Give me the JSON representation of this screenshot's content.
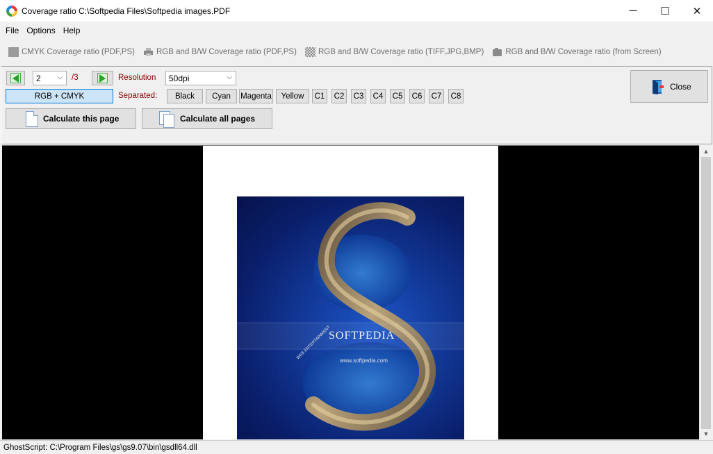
{
  "window": {
    "title": "Coverage ratio  C:\\Softpedia Files\\Softpedia images.PDF",
    "controls": [
      "─",
      "☐",
      "✕"
    ]
  },
  "menu": [
    "File",
    "Options",
    "Help"
  ],
  "mode_tabs": [
    {
      "label": "CMYK Coverage ratio  (PDF,PS)",
      "icon": "cmyk-square-icon"
    },
    {
      "label": "RGB and B/W Coverage ratio (PDF,PS)",
      "icon": "printer-icon"
    },
    {
      "label": "RGB and B/W Coverage ratio  (TIFF,JPG,BMP)",
      "icon": "checker-image-icon"
    },
    {
      "label": "RGB and B/W Coverage ratio  (from Screen)",
      "icon": "camera-icon"
    }
  ],
  "controls": {
    "page_value": "2",
    "page_total": "/3",
    "resolution_label": "Resolution",
    "resolution_value": "50dpi",
    "rgb_cmyk_label": "RGB + CMYK",
    "separated_label": "Separated:",
    "separations": [
      "Black",
      "Cyan",
      "Magenta",
      "Yellow",
      "C1",
      "C2",
      "C3",
      "C4",
      "C5",
      "C6",
      "C7",
      "C8"
    ],
    "calc_page_label": "Calculate this page",
    "calc_all_label": "Calculate all pages",
    "close_label": "Close"
  },
  "preview": {
    "brand_text": "SOFTPEDIA",
    "url_text": "www.softpedia.com",
    "side_text": "WEB ENTERTAINMENT"
  },
  "status": {
    "ghostscript": "GhostScript: C:\\Program Files\\gs\\gs9.07\\bin\\gsdll64.dll"
  },
  "colors": {
    "accent_blue": "#0078d7",
    "nav_green": "#2ca02c",
    "label_red": "#8b0000",
    "page_bg": "#000000"
  }
}
